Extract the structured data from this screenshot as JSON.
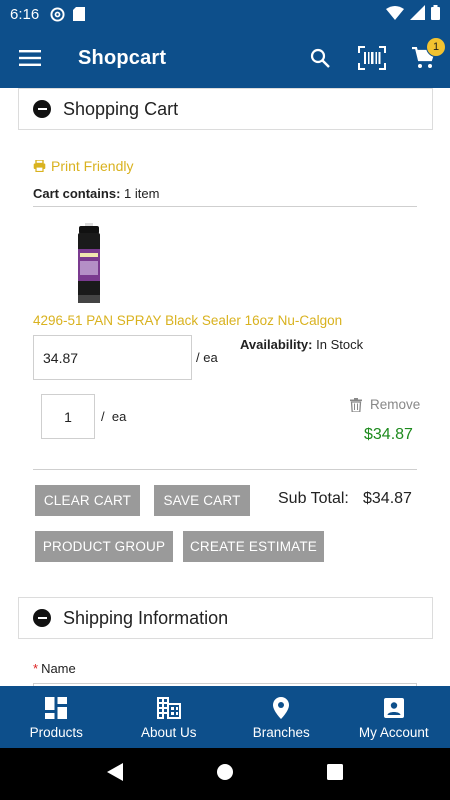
{
  "status_bar": {
    "time": "6:16"
  },
  "app_bar": {
    "title": "Shopcart",
    "cart_count": "1"
  },
  "cart_panel": {
    "title": "Shopping Cart",
    "print_label": "Print Friendly",
    "cart_contains_label": "Cart contains:",
    "cart_contains_value": "1 item",
    "item": {
      "name": "4296-51 PAN SPRAY Black Sealer 16oz Nu-Calgon",
      "price": "34.87",
      "price_unit": "/ ea",
      "availability_label": "Availability:",
      "availability_value": "In Stock",
      "quantity": "1",
      "qty_sep": "/",
      "qty_unit": "ea",
      "remove_label": "Remove",
      "line_total": "$34.87"
    },
    "buttons": {
      "clear": "CLEAR CART",
      "save": "SAVE CART",
      "product_group": "PRODUCT GROUP",
      "create_estimate": "CREATE ESTIMATE"
    },
    "subtotal_label": "Sub Total:",
    "subtotal_value": "$34.87"
  },
  "shipping_panel": {
    "title": "Shipping Information",
    "required_marker": "*",
    "name_label": "Name"
  },
  "bottom_nav": {
    "items": [
      {
        "label": "Products",
        "icon": "grid-icon"
      },
      {
        "label": "About Us",
        "icon": "building-icon"
      },
      {
        "label": "Branches",
        "icon": "location-pin-icon"
      },
      {
        "label": "My Account",
        "icon": "account-box-icon"
      }
    ]
  },
  "colors": {
    "primary": "#0d4f8b",
    "accent": "#d9b21f",
    "price_green": "#1d8a1d",
    "button_gray": "#9a9a9a",
    "badge": "#f2c230"
  }
}
